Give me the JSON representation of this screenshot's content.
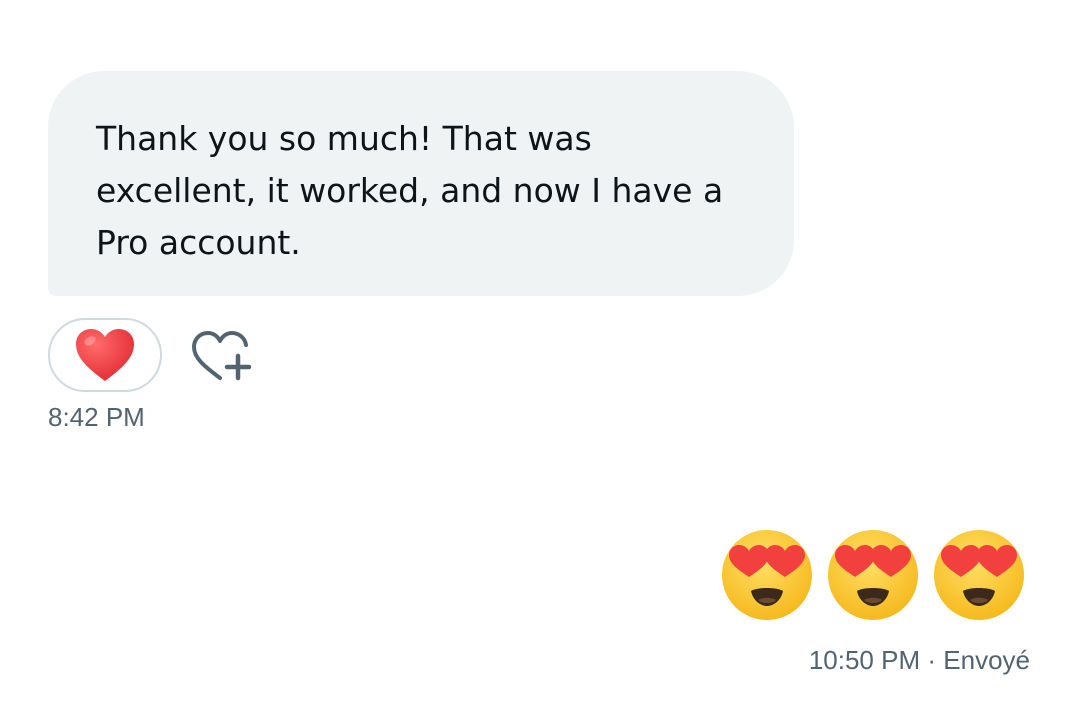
{
  "received_message": {
    "text": "Thank you so much! That was excellent, it worked, and now I have a Pro account.",
    "reaction": "red-heart",
    "time": "8:42 PM"
  },
  "sent_message": {
    "emojis": [
      "smiling-face-with-heart-eyes",
      "smiling-face-with-heart-eyes",
      "smiling-face-with-heart-eyes"
    ],
    "time": "10:50 PM",
    "separator": "·",
    "status": "Envoyé"
  },
  "colors": {
    "bubble_background": "#eff3f4",
    "text": "#0f1419",
    "meta_text": "#536471",
    "pill_border": "#cfd9de",
    "heart": "#e8353b",
    "emoji_face": "#fcc21b"
  },
  "icons": {
    "add_reaction": "heart-plus-icon"
  }
}
